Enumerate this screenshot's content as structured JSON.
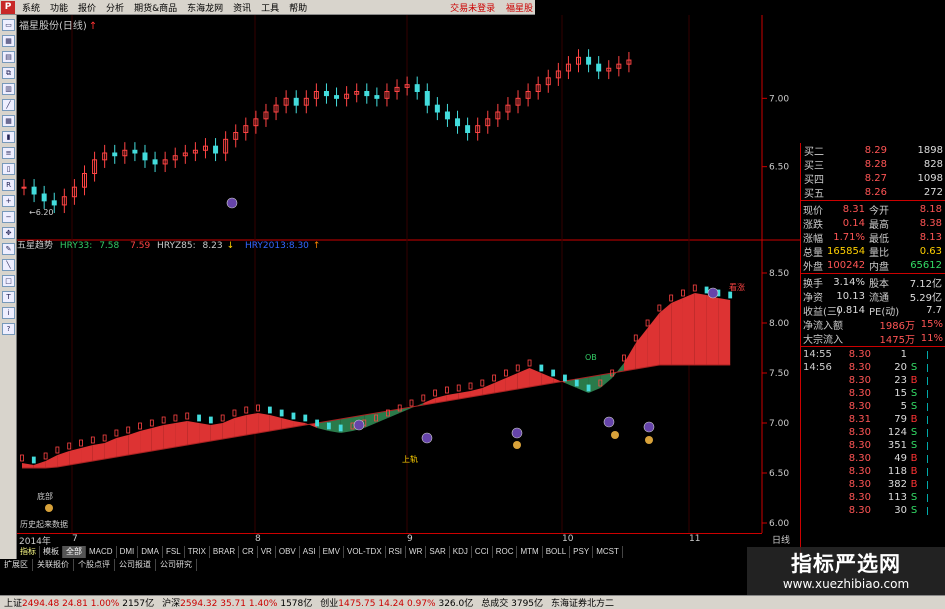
{
  "menu": {
    "logo": "P",
    "items": [
      "系统",
      "功能",
      "报价",
      "分析",
      "期货&商品",
      "东海龙网",
      "资讯",
      "工具",
      "帮助"
    ],
    "right": [
      "交易未登录",
      "福星股"
    ]
  },
  "toolbar_icons": [
    "window-icon",
    "layout-icon",
    "grid-icon",
    "chart-icon",
    "kline-icon",
    "line-icon",
    "table-icon",
    "bars-icon",
    "list-icon",
    "candle-icon",
    "rsi-icon",
    "zoom-in-icon",
    "zoom-out-icon",
    "move-icon",
    "pen-icon",
    "draw-icon",
    "box-icon",
    "text-icon",
    "info-icon",
    "help-icon"
  ],
  "price_panel": {
    "title": "福星股份(日线)",
    "low_label": "←6.20"
  },
  "indicator_panel": {
    "name": "五星趋势",
    "hry33_label": "HRY33:",
    "hry33_value": "7.58",
    "hry33_value2": "7.59",
    "hryz85_label": "HRYZ85:",
    "hryz85_value": "8.23",
    "hry_extra": "HRY2013:8.30",
    "annotations": [
      "看涨",
      "OB",
      "上轨",
      "底部",
      "历史起来数据"
    ]
  },
  "date_axis": {
    "labels": [
      "2014年",
      "7",
      "8",
      "9",
      "10",
      "11"
    ],
    "period": "日线"
  },
  "price_axis_top": [
    "7.00",
    "6.50"
  ],
  "price_axis_bottom": [
    "8.50",
    "8.00",
    "7.50",
    "7.00",
    "6.50",
    "6.00"
  ],
  "indicator_tabs": [
    "指标",
    "模板",
    "全部",
    "MACD",
    "DMI",
    "DMA",
    "FSL",
    "TRIX",
    "BRAR",
    "CR",
    "VR",
    "OBV",
    "ASI",
    "EMV",
    "VOL-TDX",
    "RSI",
    "WR",
    "SAR",
    "KDJ",
    "CCI",
    "ROC",
    "MTM",
    "BOLL",
    "PSY",
    "MCST"
  ],
  "bottom_tabs": [
    "扩展区",
    "关联报价",
    "个股点评",
    "公司报道",
    "公司研究"
  ],
  "quote": {
    "bids": [
      {
        "label": "买二",
        "price": "8.29",
        "vol": "1898"
      },
      {
        "label": "买三",
        "price": "8.28",
        "vol": "828"
      },
      {
        "label": "买四",
        "price": "8.27",
        "vol": "1098"
      },
      {
        "label": "买五",
        "price": "8.26",
        "vol": "272"
      }
    ],
    "stats": [
      {
        "l1": "现价",
        "v1": "8.31",
        "l2": "今开",
        "v2": "8.18"
      },
      {
        "l1": "涨跌",
        "v1": "0.14",
        "l2": "最高",
        "v2": "8.38"
      },
      {
        "l1": "涨幅",
        "v1": "1.71%",
        "l2": "最低",
        "v2": "8.13"
      },
      {
        "l1": "总量",
        "v1": "165854",
        "l2": "量比",
        "v2": "0.63"
      },
      {
        "l1": "外盘",
        "v1": "100242",
        "l2": "内盘",
        "v2": "65612"
      }
    ],
    "stats2": [
      {
        "l1": "换手",
        "v1": "3.14%",
        "l2": "股本",
        "v2": "7.12亿"
      },
      {
        "l1": "净资",
        "v1": "10.13",
        "l2": "流通",
        "v2": "5.29亿"
      },
      {
        "l1": "收益(三)",
        "v1": "0.814",
        "l2": "PE(动)",
        "v2": "7.7"
      }
    ],
    "flows": [
      {
        "label": "净流入额",
        "value": "1986万",
        "pct": "15%"
      },
      {
        "label": "大宗流入",
        "value": "1475万",
        "pct": "11%"
      }
    ],
    "ticks": [
      {
        "t": "14:55",
        "p": "8.30",
        "v": "1",
        "bs": ""
      },
      {
        "t": "14:56",
        "p": "8.30",
        "v": "20",
        "bs": "S"
      },
      {
        "t": "",
        "p": "8.30",
        "v": "23",
        "bs": "B"
      },
      {
        "t": "",
        "p": "8.30",
        "v": "15",
        "bs": "S"
      },
      {
        "t": "",
        "p": "8.30",
        "v": "5",
        "bs": "S"
      },
      {
        "t": "",
        "p": "8.31",
        "v": "79",
        "bs": "B"
      },
      {
        "t": "",
        "p": "8.30",
        "v": "124",
        "bs": "S"
      },
      {
        "t": "",
        "p": "8.30",
        "v": "351",
        "bs": "S"
      },
      {
        "t": "",
        "p": "8.30",
        "v": "49",
        "bs": "B"
      },
      {
        "t": "",
        "p": "8.30",
        "v": "118",
        "bs": "B"
      },
      {
        "t": "",
        "p": "8.30",
        "v": "382",
        "bs": "B"
      },
      {
        "t": "",
        "p": "8.30",
        "v": "113",
        "bs": "S"
      },
      {
        "t": "",
        "p": "8.30",
        "v": "30",
        "bs": "S"
      }
    ]
  },
  "status": {
    "sh_label": "上证",
    "sh_value": "2494.48",
    "sh_change": "24.81",
    "sh_pct": "1.00%",
    "sh_amount": "2157亿",
    "sz_label": "沪深",
    "sz_value": "2594.32",
    "sz_change": "35.71",
    "sz_pct": "1.40%",
    "sz_amount": "1578亿",
    "cy_label": "创业",
    "cy_value": "1475.75",
    "cy_change": "14.24",
    "cy_pct": "0.97%",
    "cy_amount": "326.0亿",
    "total_label": "总成交",
    "total_amount": "3795亿",
    "broker": "东海证券北方二"
  },
  "watermark": {
    "title": "指标严选网",
    "url": "www.xuezhibiao.com"
  },
  "chart_data": [
    {
      "type": "candlestick",
      "title": "福星股份(日线)",
      "ylim": [
        6.0,
        7.5
      ],
      "yticks": [
        "7.00",
        "6.50"
      ],
      "closes": [
        6.35,
        6.3,
        6.25,
        6.22,
        6.28,
        6.35,
        6.45,
        6.55,
        6.6,
        6.58,
        6.62,
        6.6,
        6.55,
        6.52,
        6.55,
        6.58,
        6.6,
        6.62,
        6.65,
        6.6,
        6.7,
        6.75,
        6.8,
        6.85,
        6.9,
        6.95,
        7.0,
        6.95,
        7.0,
        7.05,
        7.02,
        7.0,
        7.03,
        7.05,
        7.02,
        7.0,
        7.05,
        7.08,
        7.1,
        7.05,
        6.95,
        6.9,
        6.85,
        6.8,
        6.75,
        6.8,
        6.85,
        6.9,
        6.95,
        7.0,
        7.05,
        7.1,
        7.15,
        7.2,
        7.25,
        7.3,
        7.25,
        7.2,
        7.22,
        7.25,
        7.28
      ]
    },
    {
      "type": "area",
      "title": "五星趋势",
      "ylim": [
        5.9,
        8.8
      ],
      "yticks": [
        "8.50",
        "8.00",
        "7.50",
        "7.00",
        "6.50",
        "6.00"
      ],
      "series": [
        {
          "name": "HRY33",
          "values": [
            6.55,
            6.55,
            6.55,
            6.56,
            6.58,
            6.6,
            6.62,
            6.64,
            6.66,
            6.68,
            6.7,
            6.72,
            6.74,
            6.76,
            6.78,
            6.8,
            6.82,
            6.84,
            6.86,
            6.88,
            6.9,
            6.92,
            6.94,
            6.96,
            6.98,
            7.0,
            7.02,
            7.04,
            7.06,
            7.08,
            7.1,
            7.12,
            7.14,
            7.16,
            7.18,
            7.2,
            7.22,
            7.24,
            7.26,
            7.28,
            7.3,
            7.32,
            7.34,
            7.36,
            7.38,
            7.4,
            7.42,
            7.44,
            7.46,
            7.48,
            7.5,
            7.52,
            7.54,
            7.56,
            7.58,
            7.58,
            7.58,
            7.58,
            7.58,
            7.58,
            7.58
          ]
        },
        {
          "name": "HRYZ85",
          "values": [
            6.6,
            6.58,
            6.62,
            6.68,
            6.72,
            6.75,
            6.78,
            6.8,
            6.85,
            6.88,
            6.92,
            6.95,
            6.98,
            7.0,
            7.02,
            7.0,
            6.98,
            7.0,
            7.05,
            7.08,
            7.1,
            7.08,
            7.05,
            7.02,
            7.0,
            6.95,
            6.92,
            6.9,
            6.92,
            6.95,
            7.0,
            7.05,
            7.1,
            7.15,
            7.2,
            7.25,
            7.28,
            7.3,
            7.32,
            7.35,
            7.4,
            7.45,
            7.5,
            7.55,
            7.5,
            7.45,
            7.4,
            7.35,
            7.3,
            7.35,
            7.45,
            7.6,
            7.8,
            7.95,
            8.1,
            8.2,
            8.25,
            8.3,
            8.28,
            8.25,
            8.23
          ]
        }
      ]
    }
  ]
}
